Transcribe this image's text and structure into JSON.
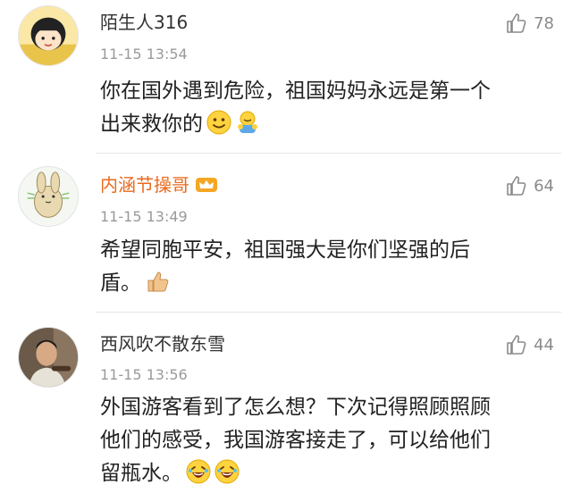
{
  "comments": [
    {
      "username": "陌生人316",
      "timestamp": "11-15 13:54",
      "likes": "78",
      "avatar_icon": "cartoon-girl-avatar",
      "body_lines": [
        "你在国外遇到危险，祖国妈妈永远是第一个",
        "出来救你的"
      ],
      "emojis": [
        "smile-emoji",
        "hug-emoji"
      ]
    },
    {
      "username": "内涵节操哥",
      "timestamp": "11-15 13:49",
      "likes": "64",
      "avatar_icon": "rabbit-avatar",
      "username_badge": "crown-icon",
      "body_lines": [
        "希望同胞平安，祖国强大是你们坚强的后",
        "盾。"
      ],
      "emojis": [
        "thumbs-up-emoji"
      ]
    },
    {
      "username": "西风吹不散东雪",
      "timestamp": "11-15 13:56",
      "likes": "44",
      "avatar_icon": "man-photo-avatar",
      "body_lines": [
        "外国游客看到了怎么想？下次记得照顾照顾",
        "他们的感受，我国游客接走了，可以给他们",
        "留瓶水。"
      ],
      "emojis": [
        "laugh-emoji",
        "laugh-emoji"
      ]
    }
  ],
  "colors": {
    "vip_name": "#e86b1f",
    "timestamp": "#9a9a9a",
    "divider": "#e6e6e6"
  }
}
